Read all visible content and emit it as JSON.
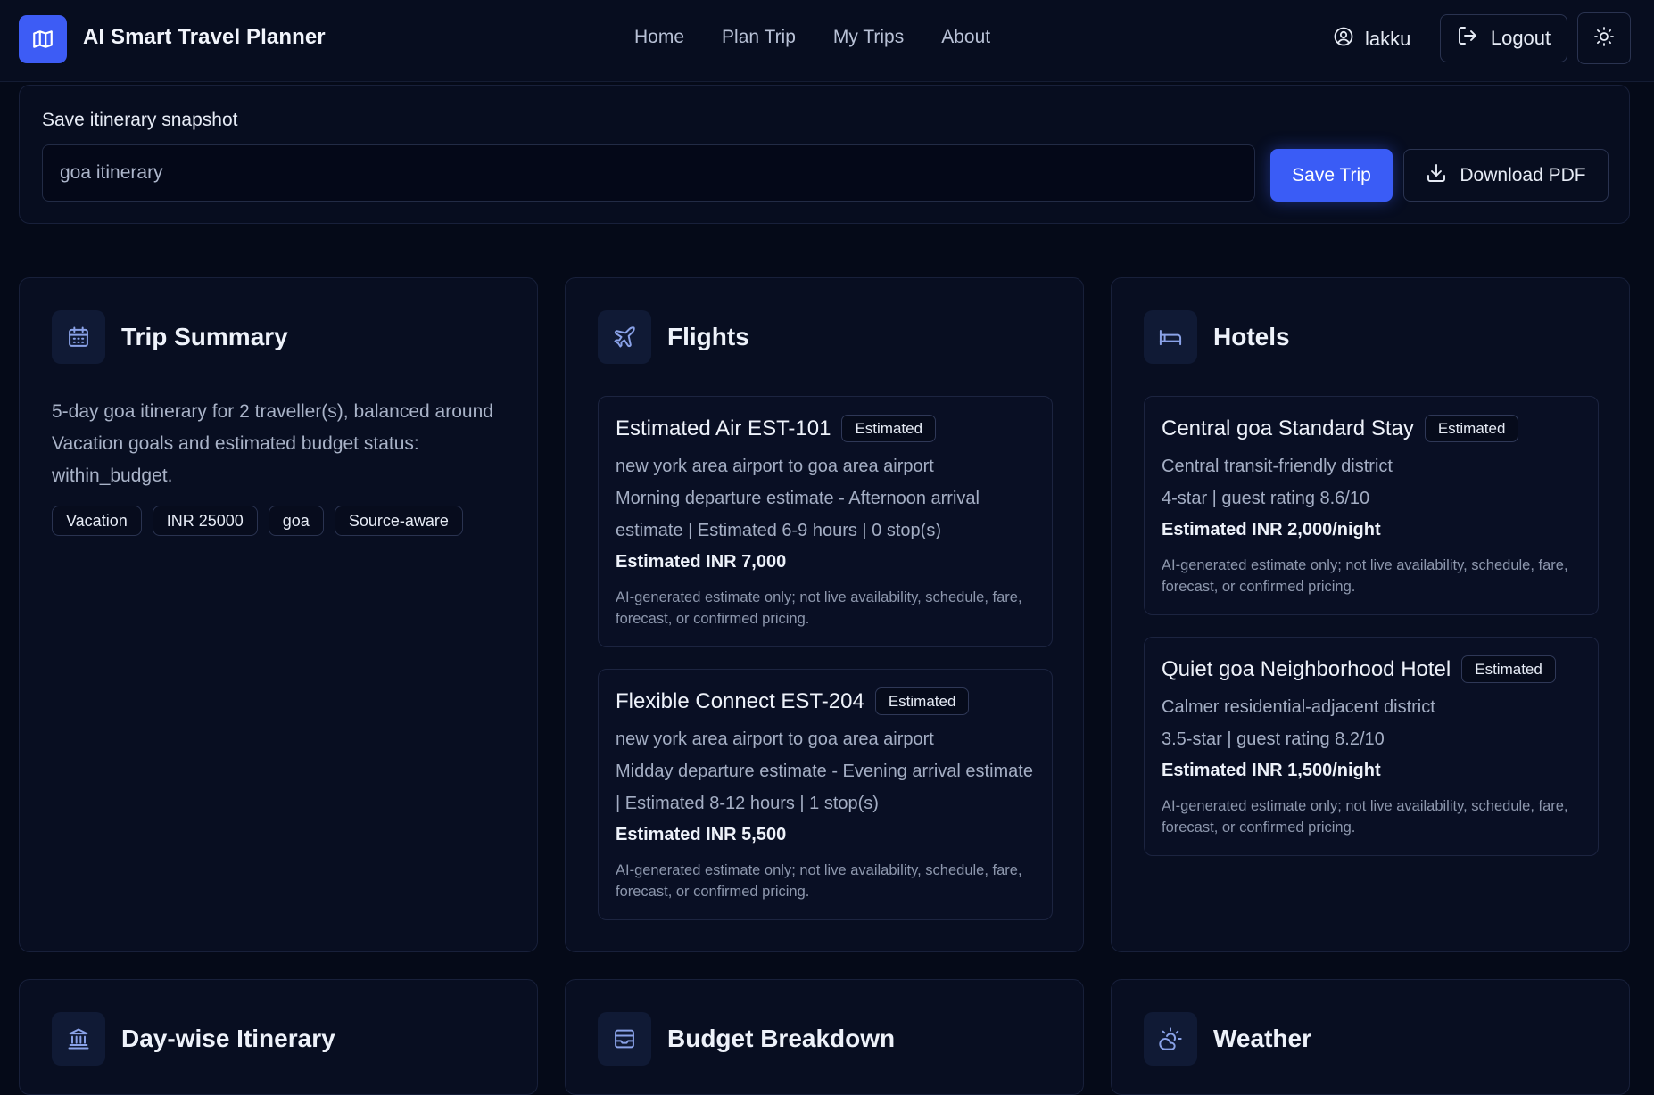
{
  "header": {
    "app_title": "AI Smart Travel Planner",
    "nav": [
      "Home",
      "Plan Trip",
      "My Trips",
      "About"
    ],
    "username": "lakku",
    "logout_label": "Logout"
  },
  "save": {
    "label": "Save itinerary snapshot",
    "input_value": "goa itinerary",
    "save_label": "Save Trip",
    "download_label": "Download PDF"
  },
  "summary": {
    "title": "Trip Summary",
    "text": "5-day goa itinerary for 2 traveller(s), balanced around Vacation goals and estimated budget status: within_budget.",
    "tags": [
      "Vacation",
      "INR 25000",
      "goa",
      "Source-aware"
    ]
  },
  "flights": {
    "title": "Flights",
    "items": [
      {
        "name": "Estimated Air EST-101",
        "badge": "Estimated",
        "route": "new york area airport to goa area airport",
        "details": "Morning departure estimate - Afternoon arrival estimate | Estimated 6-9 hours | 0 stop(s)",
        "price": "Estimated INR 7,000",
        "note": "AI-generated estimate only; not live availability, schedule, fare, forecast, or confirmed pricing."
      },
      {
        "name": "Flexible Connect EST-204",
        "badge": "Estimated",
        "route": "new york area airport to goa area airport",
        "details": "Midday departure estimate - Evening arrival estimate | Estimated 8-12 hours | 1 stop(s)",
        "price": "Estimated INR 5,500",
        "note": "AI-generated estimate only; not live availability, schedule, fare, forecast, or confirmed pricing."
      }
    ]
  },
  "hotels": {
    "title": "Hotels",
    "items": [
      {
        "name": "Central goa Standard Stay",
        "badge": "Estimated",
        "area": "Central transit-friendly district",
        "rating": "4-star | guest rating 8.6/10",
        "price": "Estimated INR 2,000/night",
        "note": "AI-generated estimate only; not live availability, schedule, fare, forecast, or confirmed pricing."
      },
      {
        "name": "Quiet goa Neighborhood Hotel",
        "badge": "Estimated",
        "area": "Calmer residential-adjacent district",
        "rating": "3.5-star | guest rating 8.2/10",
        "price": "Estimated INR 1,500/night",
        "note": "AI-generated estimate only; not live availability, schedule, fare, forecast, or confirmed pricing."
      }
    ]
  },
  "sections": {
    "itinerary_title": "Day-wise Itinerary",
    "budget_title": "Budget Breakdown",
    "weather_title": "Weather"
  },
  "icons": {
    "logo": "map-icon",
    "user": "user-circle-icon",
    "logout": "logout-icon",
    "theme": "sun-icon",
    "download": "download-icon",
    "summary": "calendar-icon",
    "flights": "plane-icon",
    "hotels": "bed-icon",
    "itinerary": "landmark-icon",
    "budget": "wallet-icon",
    "weather": "cloud-sun-icon"
  },
  "colors": {
    "accent": "#3a5cf6",
    "background": "#050a18",
    "card": "#080e21"
  }
}
